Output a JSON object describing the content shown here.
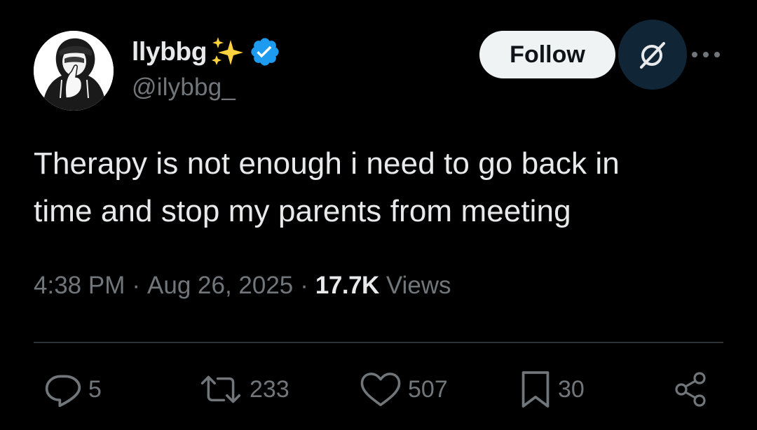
{
  "user": {
    "display_name": "llybbg",
    "handle": "@ilybbg_",
    "verified": true,
    "name_emoji_icon": "sparkles-icon",
    "avatar_icon": "hooded-figure-shush-avatar"
  },
  "header": {
    "follow_label": "Follow",
    "grok_icon": "grok-icon",
    "more_icon": "more-dots-icon"
  },
  "tweet": {
    "text_lines": [
      "Therapy is not enough i need to go back in",
      "time and stop my parents from meeting"
    ],
    "time": "4:38 PM",
    "separator": "·",
    "date": "Aug 26, 2025",
    "views_count": "17.7K",
    "views_label": "Views"
  },
  "actions": {
    "replies": "5",
    "reposts": "233",
    "likes": "507",
    "bookmarks": "30"
  },
  "colors": {
    "background": "#000000",
    "text_primary": "#e7e9ea",
    "text_secondary": "#71767b",
    "verified_blue": "#1d9bf0",
    "follow_bg": "#eff3f4",
    "grok_bg": "#102536",
    "divider": "#2f3336"
  }
}
